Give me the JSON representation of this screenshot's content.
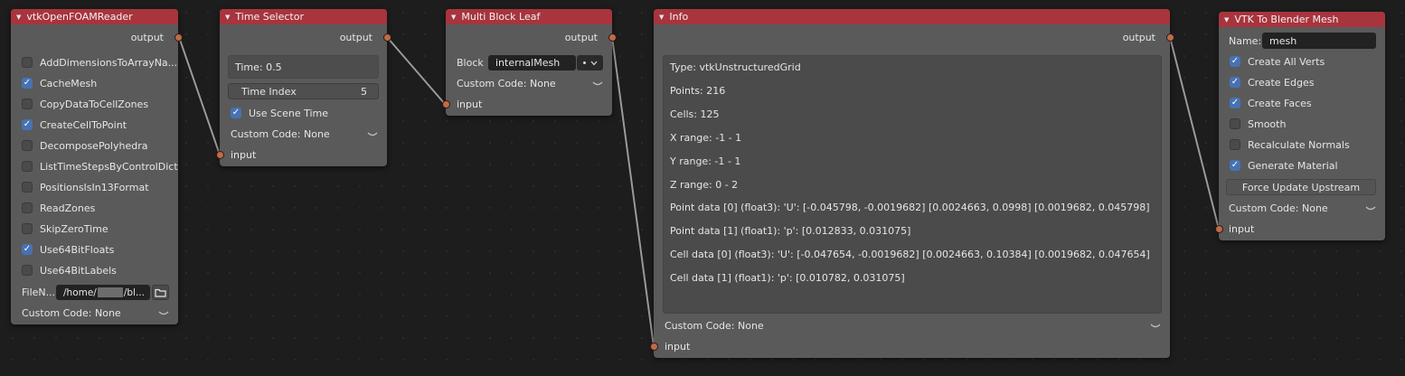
{
  "nodes": {
    "reader": {
      "title": "vtkOpenFOAMReader",
      "output_label": "output",
      "options": [
        {
          "label": "AddDimensionsToArrayNa...",
          "checked": false
        },
        {
          "label": "CacheMesh",
          "checked": true
        },
        {
          "label": "CopyDataToCellZones",
          "checked": false
        },
        {
          "label": "CreateCellToPoint",
          "checked": true
        },
        {
          "label": "DecomposePolyhedra",
          "checked": false
        },
        {
          "label": "ListTimeStepsByControlDict",
          "checked": false
        },
        {
          "label": "PositionsIsIn13Format",
          "checked": false
        },
        {
          "label": "ReadZones",
          "checked": false
        },
        {
          "label": "SkipZeroTime",
          "checked": false
        },
        {
          "label": "Use64BitFloats",
          "checked": true
        },
        {
          "label": "Use64BitLabels",
          "checked": false
        }
      ],
      "file_label": "FileN...",
      "file_value": "/home/",
      "file_value_end": "/bl...",
      "custom_code": "Custom Code: None"
    },
    "time_selector": {
      "title": "Time Selector",
      "output_label": "output",
      "time_text": "Time: 0.5",
      "time_index_label": "Time Index",
      "time_index_value": "5",
      "use_scene_time_label": "Use Scene Time",
      "use_scene_time_checked": true,
      "custom_code": "Custom Code: None",
      "input_label": "input"
    },
    "multi_block": {
      "title": "Multi Block Leaf",
      "output_label": "output",
      "block_label": "Block",
      "block_value": "internalMesh",
      "custom_code": "Custom Code: None",
      "input_label": "input"
    },
    "info": {
      "title": "Info",
      "output_label": "output",
      "lines": [
        "Type: vtkUnstructuredGrid",
        "Points: 216",
        "Cells: 125",
        "X range: -1 - 1",
        "Y range: -1 - 1",
        "Z range: 0 - 2",
        "Point data [0] (float3): 'U': [-0.045798, -0.0019682]  [0.0024663, 0.0998]  [0.0019682, 0.045798]",
        "Point data [1] (float1): 'p': [0.012833, 0.031075]",
        "Cell data [0] (float3): 'U': [-0.047654, -0.0019682]  [0.0024663, 0.10384]  [0.0019682, 0.047654]",
        "Cell data [1] (float1): 'p': [0.010782, 0.031075]"
      ],
      "custom_code": "Custom Code: None",
      "input_label": "input"
    },
    "to_blender": {
      "title": "VTK To Blender Mesh",
      "name_label": "Name:",
      "name_value": "mesh",
      "options": [
        {
          "label": "Create All Verts",
          "checked": true
        },
        {
          "label": "Create Edges",
          "checked": true
        },
        {
          "label": "Create Faces",
          "checked": true
        },
        {
          "label": "Smooth",
          "checked": false
        },
        {
          "label": "Recalculate Normals",
          "checked": false
        },
        {
          "label": "Generate Material",
          "checked": true
        }
      ],
      "force_update_label": "Force Update Upstream",
      "custom_code": "Custom Code: None",
      "input_label": "input"
    }
  },
  "colors": {
    "header": "#a8343d",
    "socket": "#c06a48",
    "checkbox_on": "#4772b3"
  }
}
